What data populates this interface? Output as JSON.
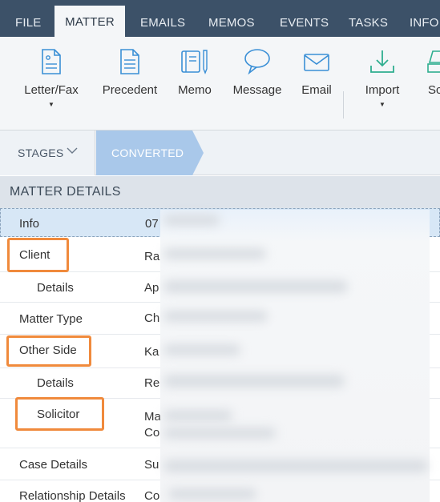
{
  "tabs": [
    "FILE",
    "MATTER",
    "EMAILS",
    "MEMOS",
    "EVENTS",
    "TASKS",
    "INFO"
  ],
  "active_tab": "MATTER",
  "ribbon": {
    "letter_fax": "Letter/Fax",
    "precedent": "Precedent",
    "memo": "Memo",
    "message": "Message",
    "email": "Email",
    "import": "Import",
    "scan": "Sc",
    "caret": "▼"
  },
  "stages": {
    "label": "STAGES",
    "current": "CONVERTED"
  },
  "matter_details": {
    "title": "MATTER DETAILS",
    "rows": [
      {
        "label": "Info",
        "value": "07"
      },
      {
        "label": "Client",
        "value": "Ra"
      },
      {
        "label": "Details",
        "value": "Ap"
      },
      {
        "label": "Matter Type",
        "value": "Ch"
      },
      {
        "label": "Other Side",
        "value": "Ka"
      },
      {
        "label": "Details",
        "value": "Re"
      },
      {
        "label": "Solicitor",
        "value": "Ma",
        "value2": "Co"
      },
      {
        "label": "Case Details",
        "value": "Su"
      },
      {
        "label": "Relationship Details",
        "value": "Co"
      }
    ]
  },
  "colors": {
    "tabbar": "#3c5168",
    "ribbon_icon": "#3a8fd6",
    "import_icon": "#2fae8f",
    "converted": "#a9c8ea",
    "highlight": "#f08a3c"
  }
}
